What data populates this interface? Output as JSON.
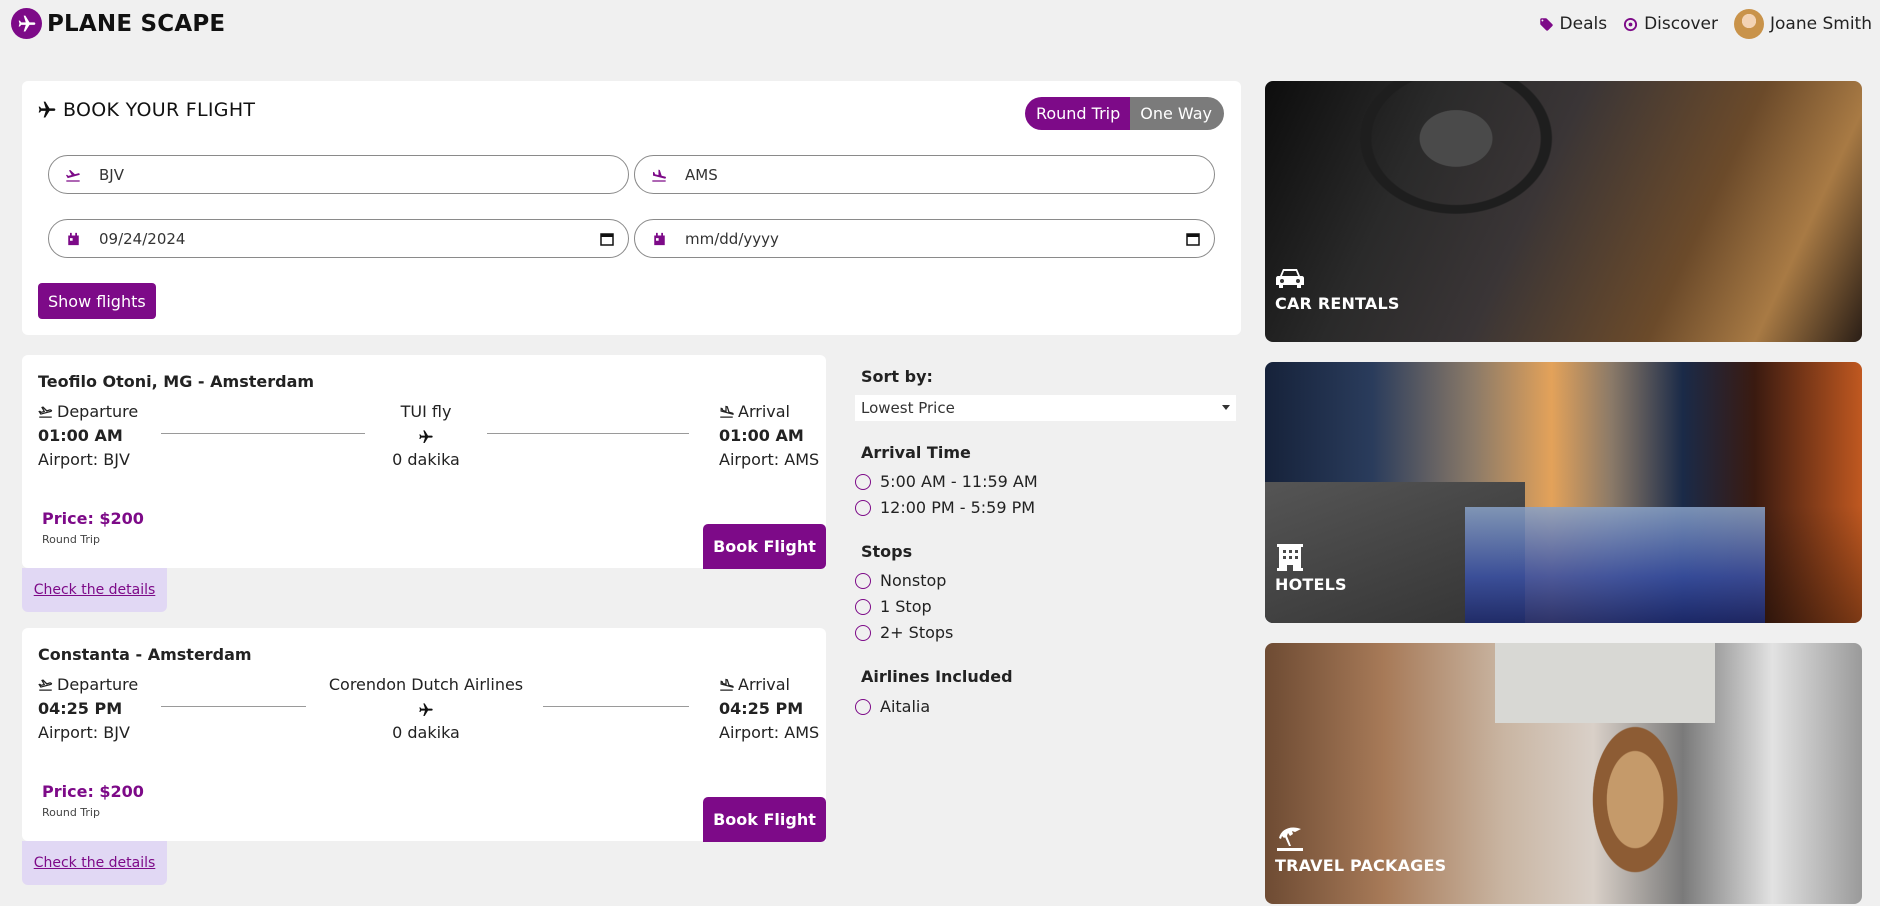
{
  "header": {
    "logo_text": "PLANE SCAPE",
    "nav": [
      {
        "label": "Deals",
        "icon": "tag-icon"
      },
      {
        "label": "Discover",
        "icon": "globe-icon"
      }
    ],
    "user_name": "Joane Smith"
  },
  "booking": {
    "title": "BOOK YOUR FLIGHT",
    "trip_types": [
      "Round Trip",
      "One Way"
    ],
    "selected_trip_type": "Round Trip",
    "from_value": "BJV",
    "to_value": "AMS",
    "depart_date": "09/24/2024",
    "return_date_placeholder": "mm/dd/yyyy",
    "search_button": "Show flights"
  },
  "flights": [
    {
      "route": "Teofilo Otoni, MG - Amsterdam",
      "departure_label": "Departure",
      "departure_time": "01:00 AM",
      "departure_airport": "Airport: BJV",
      "airline": "TUI fly",
      "duration": "0 dakika",
      "arrival_label": "Arrival",
      "arrival_time": "01:00 AM",
      "arrival_airport": "Airport: AMS",
      "price": "Price: $200",
      "trip_type": "Round Trip",
      "book_label": "Book Flight",
      "details_label": "Check the details"
    },
    {
      "route": "Constanta - Amsterdam",
      "departure_label": "Departure",
      "departure_time": "04:25 PM",
      "departure_airport": "Airport: BJV",
      "airline": "Corendon Dutch Airlines",
      "duration": "0 dakika",
      "arrival_label": "Arrival",
      "arrival_time": "04:25 PM",
      "arrival_airport": "Airport: AMS",
      "price": "Price: $200",
      "trip_type": "Round Trip",
      "book_label": "Book Flight",
      "details_label": "Check the details"
    }
  ],
  "filters": {
    "sort_label": "Sort by:",
    "sort_value": "Lowest Price",
    "arrival_time_label": "Arrival Time",
    "arrival_times": [
      "5:00 AM - 11:59 AM",
      "12:00 PM - 5:59 PM"
    ],
    "stops_label": "Stops",
    "stops": [
      "Nonstop",
      "1 Stop",
      "2+ Stops"
    ],
    "airlines_label": "Airlines Included",
    "airlines": [
      "Aitalia"
    ]
  },
  "promos": [
    {
      "label": "CAR RENTALS",
      "icon": "car-icon"
    },
    {
      "label": "HOTELS",
      "icon": "hotel-icon"
    },
    {
      "label": "TRAVEL PACKAGES",
      "icon": "beach-umbrella-icon"
    }
  ],
  "colors": {
    "brand": "#7d0a88",
    "page_background": "#f0f0f0",
    "details_background": "#e1d8f4",
    "toggle_inactive": "#7b7b7b"
  }
}
